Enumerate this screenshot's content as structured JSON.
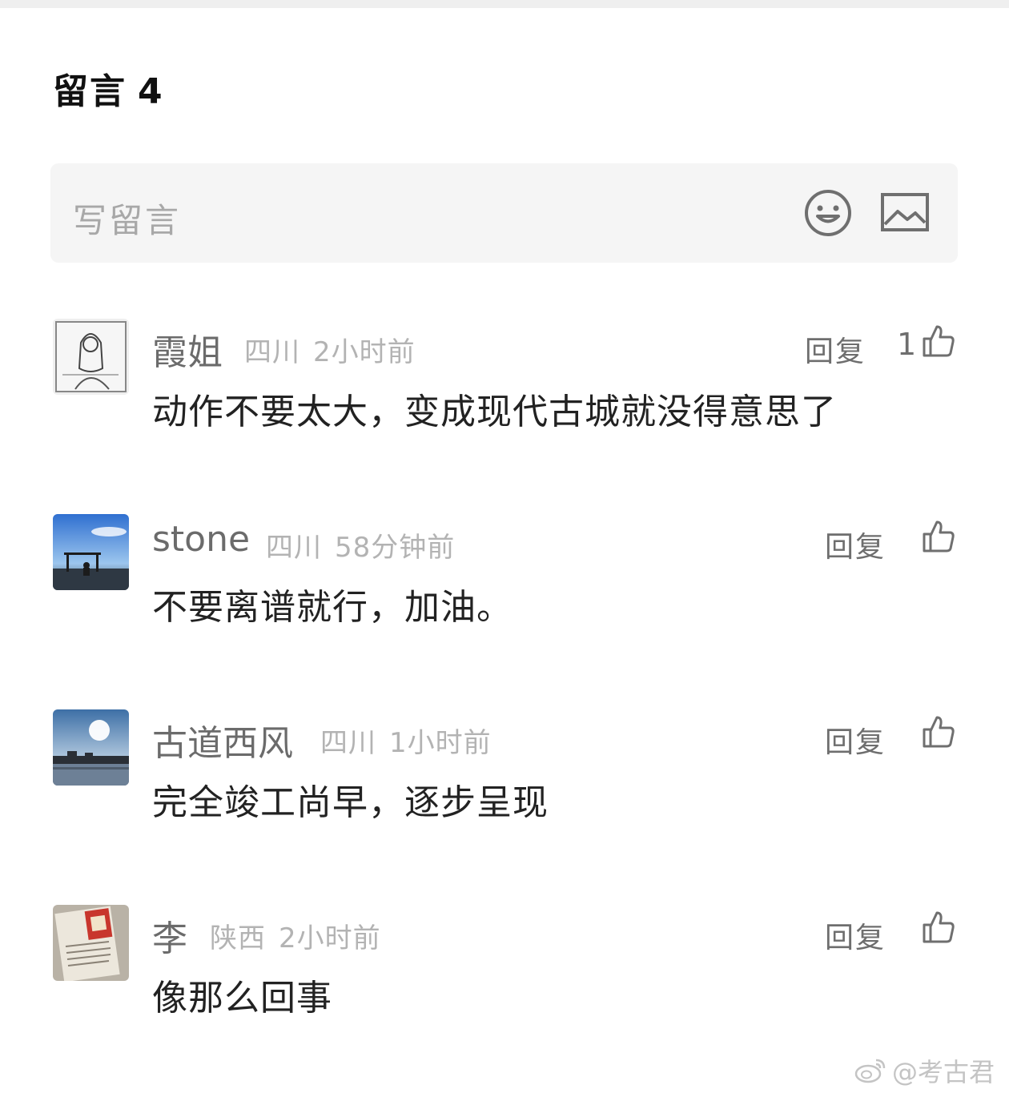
{
  "header": {
    "title": "留言",
    "count": "4"
  },
  "composer": {
    "placeholder": "写留言",
    "emoji_icon": "smiley-face-icon",
    "image_icon": "image-icon"
  },
  "comments": [
    {
      "name": "霞姐",
      "location": "四川",
      "time": "2小时前",
      "reply_label": "回复",
      "likes": "1",
      "text": "动作不要太大，变成现代古城就没得意思了"
    },
    {
      "name": "stone",
      "location": "四川",
      "time": "58分钟前",
      "reply_label": "回复",
      "likes": "",
      "text": "不要离谱就行，加油。"
    },
    {
      "name": "古道西风",
      "location": "四川",
      "time": "1小时前",
      "reply_label": "回复",
      "likes": "",
      "text": "完全竣工尚早，逐步呈现"
    },
    {
      "name": "李",
      "location": "陕西",
      "time": "2小时前",
      "reply_label": "回复",
      "likes": "",
      "text": "像那么回事"
    }
  ],
  "watermark": {
    "text": "@考古君"
  }
}
